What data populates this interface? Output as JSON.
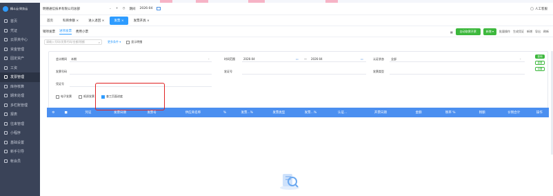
{
  "brand": {
    "name": "精斗云·财务云"
  },
  "top_bar": {
    "company": "明德通信技术有限公司总部",
    "period_label": "期间",
    "period_value": "2026-04",
    "service": "人工客服"
  },
  "sidebar": {
    "items": [
      {
        "label": "首页",
        "icon": "home-icon"
      },
      {
        "label": "凭证",
        "icon": "voucher-icon"
      },
      {
        "label": "云票夹中心",
        "icon": "folder-icon"
      },
      {
        "label": "资金管理",
        "icon": "money-icon"
      },
      {
        "label": "固定资产",
        "icon": "asset-icon"
      },
      {
        "label": "工资",
        "icon": "salary-icon"
      },
      {
        "label": "发票管理",
        "icon": "invoice-icon",
        "active": true
      },
      {
        "label": "库存核算",
        "icon": "inventory-icon"
      },
      {
        "label": "期末处理",
        "icon": "period-end-icon"
      },
      {
        "label": "多栏账管理",
        "icon": "ledger-icon"
      },
      {
        "label": "报表",
        "icon": "report-icon"
      },
      {
        "label": "往来管理",
        "icon": "contact-icon"
      },
      {
        "label": "小程序",
        "icon": "miniapp-icon"
      },
      {
        "label": "基础设置",
        "icon": "settings-icon"
      },
      {
        "label": "新手引导",
        "icon": "guide-icon"
      },
      {
        "label": "帐会员",
        "icon": "vip-icon"
      }
    ]
  },
  "tabs": [
    {
      "label": "首页",
      "closable": false
    },
    {
      "label": "科目余额 ×",
      "closable": true
    },
    {
      "label": "进入退回 ×",
      "closable": true
    },
    {
      "label": "发票 ×",
      "closable": true,
      "active": true
    },
    {
      "label": "发票开具 ×",
      "closable": true
    }
  ],
  "subtabs": [
    {
      "label": "销项发票"
    },
    {
      "label": "进项发票",
      "active": true
    },
    {
      "label": "费用小票"
    }
  ],
  "actions": {
    "primary": "自动取票开票",
    "secondary": "新增 ▾",
    "items": [
      "批量操作",
      "生成凭证",
      "新增",
      "导出",
      "刷新"
    ]
  },
  "search": {
    "placeholder": "请输入号码/发票代码/金额/税额",
    "more_filter": "更多条件 ▾",
    "show_detail": "显示明细"
  },
  "filter": {
    "account_period_label": "会计期间",
    "account_period_value": "本期",
    "date_range_label": "时间范围",
    "date_start": "2026-04",
    "date_sep": "—",
    "date_end": "2026-04",
    "auth_status_label": "认证状态",
    "auth_status_value": "全部",
    "invoice_no_label": "发票号码",
    "invoice_code_label": "发证号",
    "invoice_type_label": "发票类型",
    "voucher_no_label": "凭证号",
    "query_button": "查询",
    "reset_button": "重置",
    "settings_button": "设置"
  },
  "checks": [
    {
      "label": "电子发票",
      "checked": false
    },
    {
      "label": "纸质发票",
      "checked": false
    },
    {
      "label": "查工页面进度",
      "checked": true
    }
  ],
  "table_headers": [
    "凭证",
    "发票日期",
    "发票号",
    "供应商名称",
    "%",
    "发票...%",
    "发票类型",
    "发票...%",
    "认证...",
    "开票日期",
    "金额",
    "税率 %",
    "税额",
    "价税合计",
    "操作"
  ]
}
